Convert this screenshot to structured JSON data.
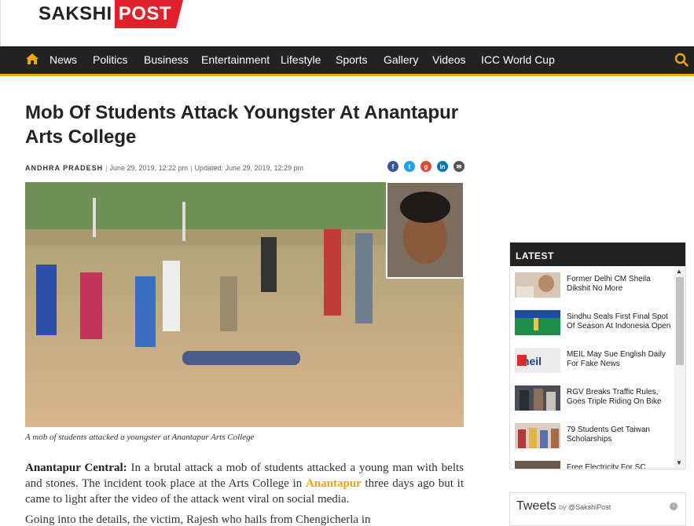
{
  "brand": {
    "part1": "SAKSHI",
    "part2": "POST"
  },
  "nav": {
    "items": [
      "News",
      "Politics",
      "Business",
      "Entertainment",
      "Lifestyle",
      "Sports",
      "Gallery",
      "Videos",
      "ICC World Cup"
    ]
  },
  "article": {
    "title": "Mob Of Students Attack Youngster At Anantapur Arts College",
    "category": "ANDHRA PRADESH",
    "published": "June 29, 2019, 12:22 pm",
    "updated": "Updated: June 29, 2019, 12:29 pm",
    "caption": "A mob of students attacked a youngster at Anantapur Arts College",
    "lead_label": "Anantapur Central:",
    "lead_text_1": " In a brutal attack a mob of students attacked a young man with belts and stones. The incident took place at the Arts College in ",
    "lead_link": "Anantapur",
    "lead_text_2": " three days ago but it came to light after the video of the attack went viral on social media.",
    "para2": "Going into the details, the victim, Rajesh who hails from Chengicherla in"
  },
  "share_icons": [
    "facebook-icon",
    "twitter-icon",
    "google-plus-icon",
    "linkedin-icon",
    "email-icon"
  ],
  "sidebar": {
    "latest_title": "LATEST",
    "items": [
      {
        "title": "Former Delhi CM Sheila Dikshit No More"
      },
      {
        "title": "Sindhu Seals First Final Spot Of Season At Indonesia Open"
      },
      {
        "title": "MEIL May Sue English Daily For Fake News"
      },
      {
        "title": "RGV Breaks Traffic Rules, Goes Triple Riding On Bike"
      },
      {
        "title": "79 Students Get Taiwan Scholarships"
      },
      {
        "title": "Free Electricity For SC"
      }
    ],
    "tweets_title": "Tweets",
    "tweets_by": "by",
    "tweets_handle": "@SakshiPost"
  },
  "colors": {
    "accent": "#f0a500",
    "brand_red": "#e0202a",
    "nav_bg": "#222222"
  }
}
